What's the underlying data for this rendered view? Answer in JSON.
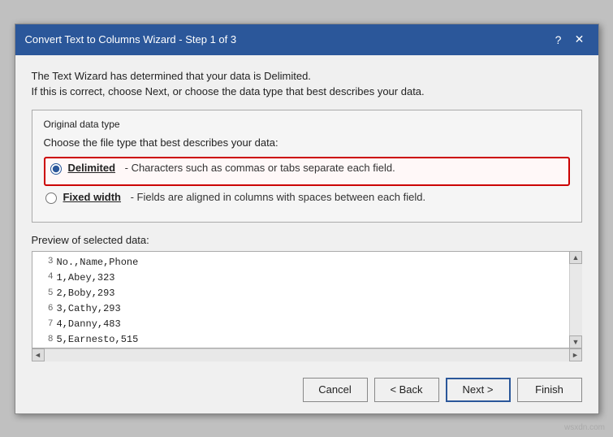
{
  "titleBar": {
    "title": "Convert Text to Columns Wizard - Step 1 of 3",
    "helpBtn": "?",
    "closeBtn": "✕"
  },
  "intro": {
    "line1": "The Text Wizard has determined that your data is Delimited.",
    "line2": "If this is correct, choose Next, or choose the data type that best describes your data."
  },
  "groupBox": {
    "label": "Original data type",
    "radioGroupLabel": "Choose the file type that best describes your data:"
  },
  "options": [
    {
      "id": "delimited",
      "label": "Delimited",
      "desc": "- Characters such as commas or tabs separate each field.",
      "selected": true
    },
    {
      "id": "fixed-width",
      "label": "Fixed width",
      "desc": "- Fields are aligned in columns with spaces between each field.",
      "selected": false
    }
  ],
  "preview": {
    "label": "Preview of selected data:",
    "rows": [
      {
        "num": "3",
        "content": "No.,Name,Phone"
      },
      {
        "num": "4",
        "content": "1,Abey,323"
      },
      {
        "num": "5",
        "content": "2,Boby,293"
      },
      {
        "num": "6",
        "content": "3,Cathy,293"
      },
      {
        "num": "7",
        "content": "4,Danny,483"
      },
      {
        "num": "8",
        "content": "5,Earnesto,515"
      }
    ]
  },
  "buttons": {
    "cancel": "Cancel",
    "back": "< Back",
    "next": "Next >",
    "finish": "Finish"
  },
  "watermark": "wsxdn.com"
}
